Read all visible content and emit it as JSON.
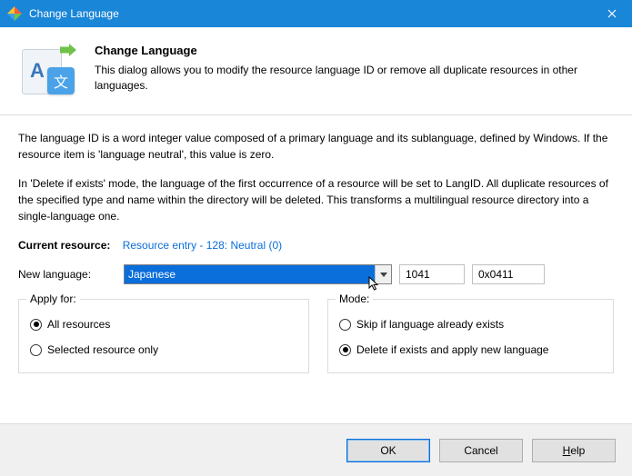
{
  "window": {
    "title": "Change Language"
  },
  "header": {
    "heading": "Change Language",
    "description": "This dialog allows you to modify the resource language ID or remove all duplicate resources in other languages."
  },
  "body": {
    "info1": "The language ID is a word integer value composed of a primary language and its sublanguage, defined by Windows. If the resource item is 'language neutral', this value is zero.",
    "info2": "In 'Delete if exists' mode, the language of the first occurrence of a resource will be set to LangID. All duplicate resources of the specified type and name within the directory will be deleted. This transforms a multilingual resource directory into a single-language one.",
    "current_label": "Current resource:",
    "current_link": "Resource entry - 128: Neutral (0)",
    "newlang_label": "New language:",
    "selected_language": "Japanese",
    "lang_dec": "1041",
    "lang_hex": "0x0411"
  },
  "apply": {
    "legend": "Apply for:",
    "all": "All resources",
    "selected": "Selected resource only",
    "choice": "all"
  },
  "mode": {
    "legend": "Mode:",
    "skip": "Skip if language already exists",
    "delete": "Delete if exists and apply new language",
    "choice": "delete"
  },
  "buttons": {
    "ok": "OK",
    "cancel": "Cancel",
    "help": "Help"
  }
}
